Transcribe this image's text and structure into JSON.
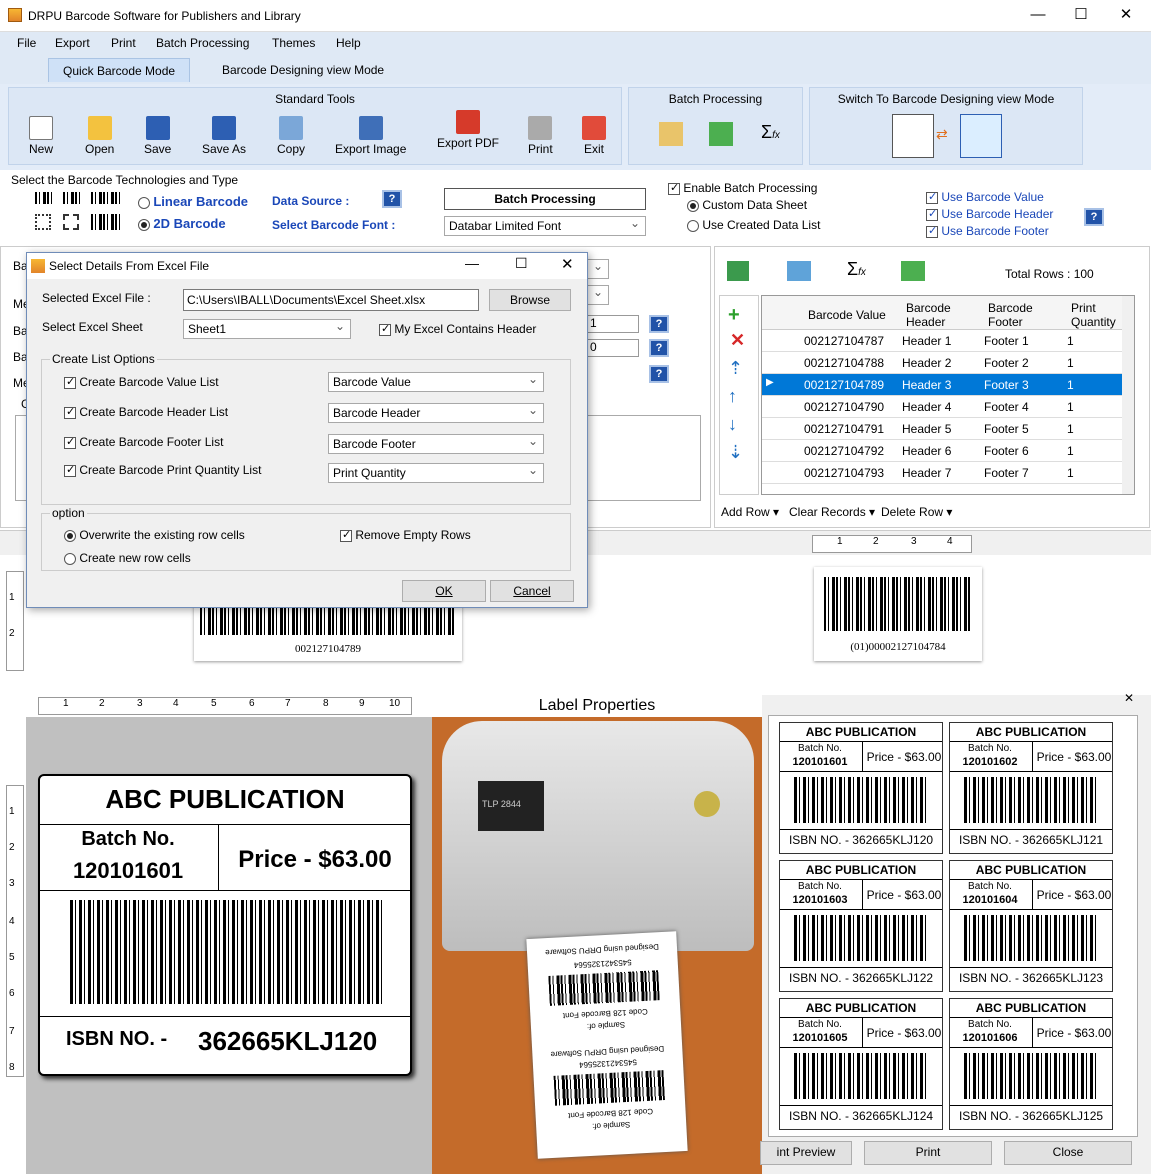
{
  "window": {
    "title": "DRPU Barcode Software for Publishers and Library"
  },
  "menu": [
    "File",
    "Export",
    "Print",
    "Batch Processing",
    "Themes",
    "Help"
  ],
  "tabs": [
    "Quick Barcode Mode",
    "Barcode Designing view Mode"
  ],
  "ribbon": {
    "standard_title": "Standard Tools",
    "tools": [
      "New",
      "Open",
      "Save",
      "Save As",
      "Copy",
      "Export Image",
      "Export PDF",
      "Print",
      "Exit"
    ],
    "batch_title": "Batch Processing",
    "switch_title": "Switch To Barcode Designing view Mode"
  },
  "tech": {
    "title": "Select the Barcode Technologies and Type",
    "linear": "Linear Barcode",
    "twod": "2D Barcode",
    "data_source": "Data Source :",
    "batch_btn": "Batch Processing",
    "font_label": "Select Barcode Font :",
    "font_value": "Databar Limited Font"
  },
  "batch_opts": {
    "enable": "Enable Batch Processing",
    "custom": "Custom Data Sheet",
    "created": "Use Created Data List",
    "use_value": "Use Barcode Value",
    "use_header": "Use Barcode Header",
    "use_footer": "Use Barcode Footer"
  },
  "grid": {
    "total_rows": "Total Rows : 100",
    "headers": [
      "Barcode Value",
      "Barcode Header",
      "Barcode Footer",
      "Print Quantity"
    ],
    "rows": [
      [
        "002127104787",
        "Header 1",
        "Footer 1",
        "1"
      ],
      [
        "002127104788",
        "Header 2",
        "Footer 2",
        "1"
      ],
      [
        "002127104789",
        "Header 3",
        "Footer 3",
        "1"
      ],
      [
        "002127104790",
        "Header 4",
        "Footer 4",
        "1"
      ],
      [
        "002127104791",
        "Header 5",
        "Footer 5",
        "1"
      ],
      [
        "002127104792",
        "Header 6",
        "Footer 6",
        "1"
      ],
      [
        "002127104793",
        "Header 7",
        "Footer 7",
        "1"
      ]
    ],
    "add_row": "Add Row",
    "clear": "Clear Records",
    "delete": "Delete Row"
  },
  "dialog": {
    "title": "Select Details From Excel File",
    "file_label": "Selected Excel File :",
    "file_value": "C:\\Users\\IBALL\\Documents\\Excel Sheet.xlsx",
    "browse": "Browse",
    "sheet_label": "Select Excel Sheet",
    "sheet_value": "Sheet1",
    "header_chk": "My Excel Contains Header",
    "list_group": "Create List Options",
    "lists": [
      {
        "label": "Create Barcode Value List",
        "value": "Barcode Value"
      },
      {
        "label": "Create Barcode Header List",
        "value": "Barcode Header"
      },
      {
        "label": "Create Barcode Footer List",
        "value": "Barcode Footer"
      },
      {
        "label": "Create Barcode Print Quantity List",
        "value": "Print Quantity"
      }
    ],
    "option_group": "option",
    "overwrite": "Overwrite the existing row cells",
    "new_rows": "Create new row cells",
    "remove_empty": "Remove Empty Rows",
    "ok": "OK",
    "cancel": "Cancel"
  },
  "left_labels": [
    "Ba",
    "Me",
    "Ba",
    "Ba",
    "Me",
    "G"
  ],
  "spin_values": [
    "1",
    "0"
  ],
  "preview": {
    "barcode1_text": "002127104789",
    "barcode2_text": "(01)00002127104784"
  },
  "ruler_nums": [
    "1",
    "2",
    "3",
    "4",
    "5",
    "6",
    "7",
    "8",
    "9",
    "10"
  ],
  "big_label": {
    "title": "ABC PUBLICATION",
    "batch": "Batch No.",
    "batch_no": "120101601",
    "price": "Price - $63.00",
    "isbn_prefix": "ISBN NO. -",
    "isbn": "362665KLJ120"
  },
  "label_props": "Label Properties",
  "print_preview": {
    "cards": [
      {
        "title": "ABC PUBLICATION",
        "batch": "Batch No.",
        "no": "120101601",
        "price": "Price - $63.00",
        "isbn": "ISBN NO. - 362665KLJ120"
      },
      {
        "title": "ABC PUBLICATION",
        "batch": "Batch No.",
        "no": "120101602",
        "price": "Price - $63.00",
        "isbn": "ISBN NO. - 362665KLJ121"
      },
      {
        "title": "ABC PUBLICATION",
        "batch": "Batch No.",
        "no": "120101603",
        "price": "Price - $63.00",
        "isbn": "ISBN NO. - 362665KLJ122"
      },
      {
        "title": "ABC PUBLICATION",
        "batch": "Batch No.",
        "no": "120101604",
        "price": "Price - $63.00",
        "isbn": "ISBN NO. - 362665KLJ123"
      },
      {
        "title": "ABC PUBLICATION",
        "batch": "Batch No.",
        "no": "120101605",
        "price": "Price - $63.00",
        "isbn": "ISBN NO. - 362665KLJ124"
      },
      {
        "title": "ABC PUBLICATION",
        "batch": "Batch No.",
        "no": "120101606",
        "price": "Price - $63.00",
        "isbn": "ISBN NO. - 362665KLJ125"
      }
    ],
    "btn_preview": "int Preview",
    "btn_print": "Print",
    "btn_close": "Close"
  },
  "printer": {
    "model": "TLP 2844",
    "tag1": "Designed using DRPU Software",
    "tag2": "5453421325564",
    "tag3": "Code 128 Barcode Font",
    "tag4": "Sample of:"
  }
}
